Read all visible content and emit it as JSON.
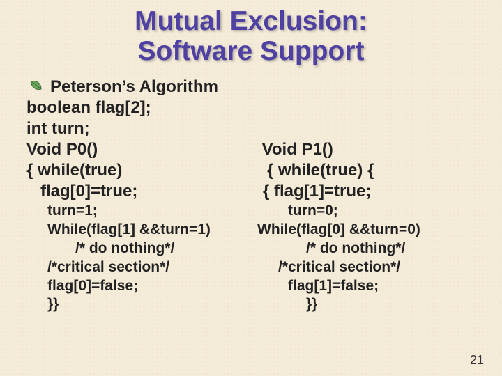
{
  "title_line1": "Mutual Exclusion:",
  "title_line2": "Software Support",
  "bullet": "Peterson’s Algorithm",
  "decl1": "boolean flag[2];",
  "decl2": "int turn;",
  "p0": {
    "sig": "Void P0()",
    "w": "{ while(true)",
    "f0": "   flag[0]=true;",
    "t": "turn=1;",
    "wc": "While(flag[1] &&turn=1)",
    "dn": "/* do nothing*/",
    "cs": "/*critical section*/",
    "ff": "flag[0]=false;",
    "end": "}}"
  },
  "p1": {
    "sig": " Void P1()",
    "w": "{ while(true) {",
    "f0": "{ flag[1]=true;",
    "t": "turn=0;",
    "wc": "While(flag[0] &&turn=0)",
    "dn": "/* do nothing*/",
    "cs": "/*critical section*/",
    "ff": "flag[1]=false;",
    "end": "}}"
  },
  "page": "21"
}
